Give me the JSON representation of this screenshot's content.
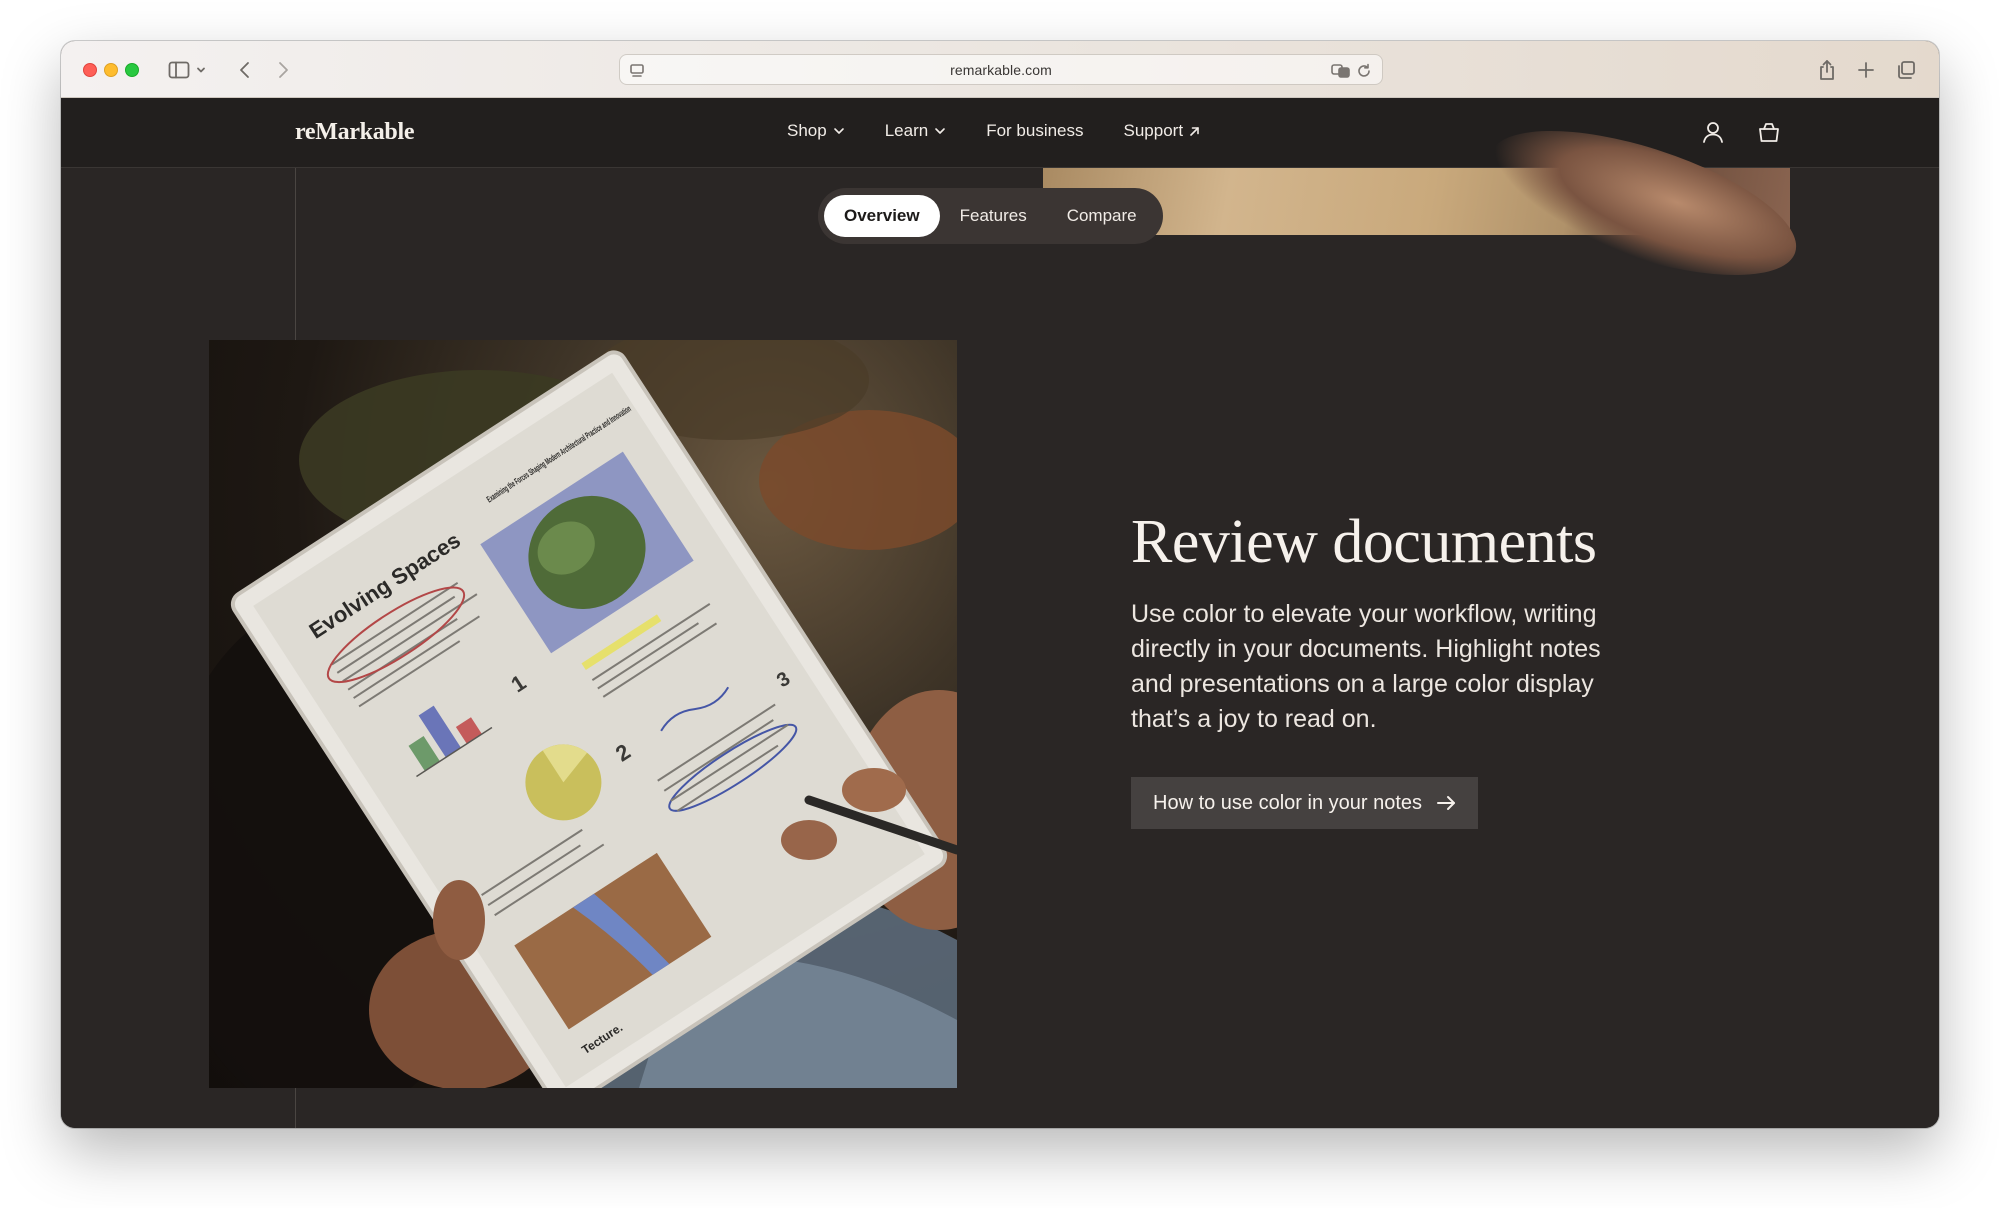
{
  "browser": {
    "url": "remarkable.com"
  },
  "site": {
    "logo": "reMarkable",
    "nav": [
      {
        "label": "Shop"
      },
      {
        "label": "Learn"
      },
      {
        "label": "For business"
      },
      {
        "label": "Support"
      }
    ]
  },
  "subnav": {
    "tabs": [
      {
        "label": "Overview",
        "active": true
      },
      {
        "label": "Features",
        "active": false
      },
      {
        "label": "Compare",
        "active": false
      }
    ]
  },
  "feature": {
    "title": "Review documents",
    "body": "Use color to elevate your workflow, writing directly in your documents. Highlight notes and presentations on a large color display that’s a joy to read on.",
    "cta_label": "How to use color in your notes"
  },
  "device_screen": {
    "heading": "Evolving Spaces",
    "subheading": "Examining the Forces Shaping Modern Architectural Practice and Innovation",
    "numbers": [
      "1",
      "2",
      "3"
    ],
    "footer": "Tecture."
  },
  "colors": {
    "page_bg": "#2a2625",
    "header_bg": "#221f1e",
    "cta_bg": "#454140",
    "text_light": "#f6f1ec"
  }
}
